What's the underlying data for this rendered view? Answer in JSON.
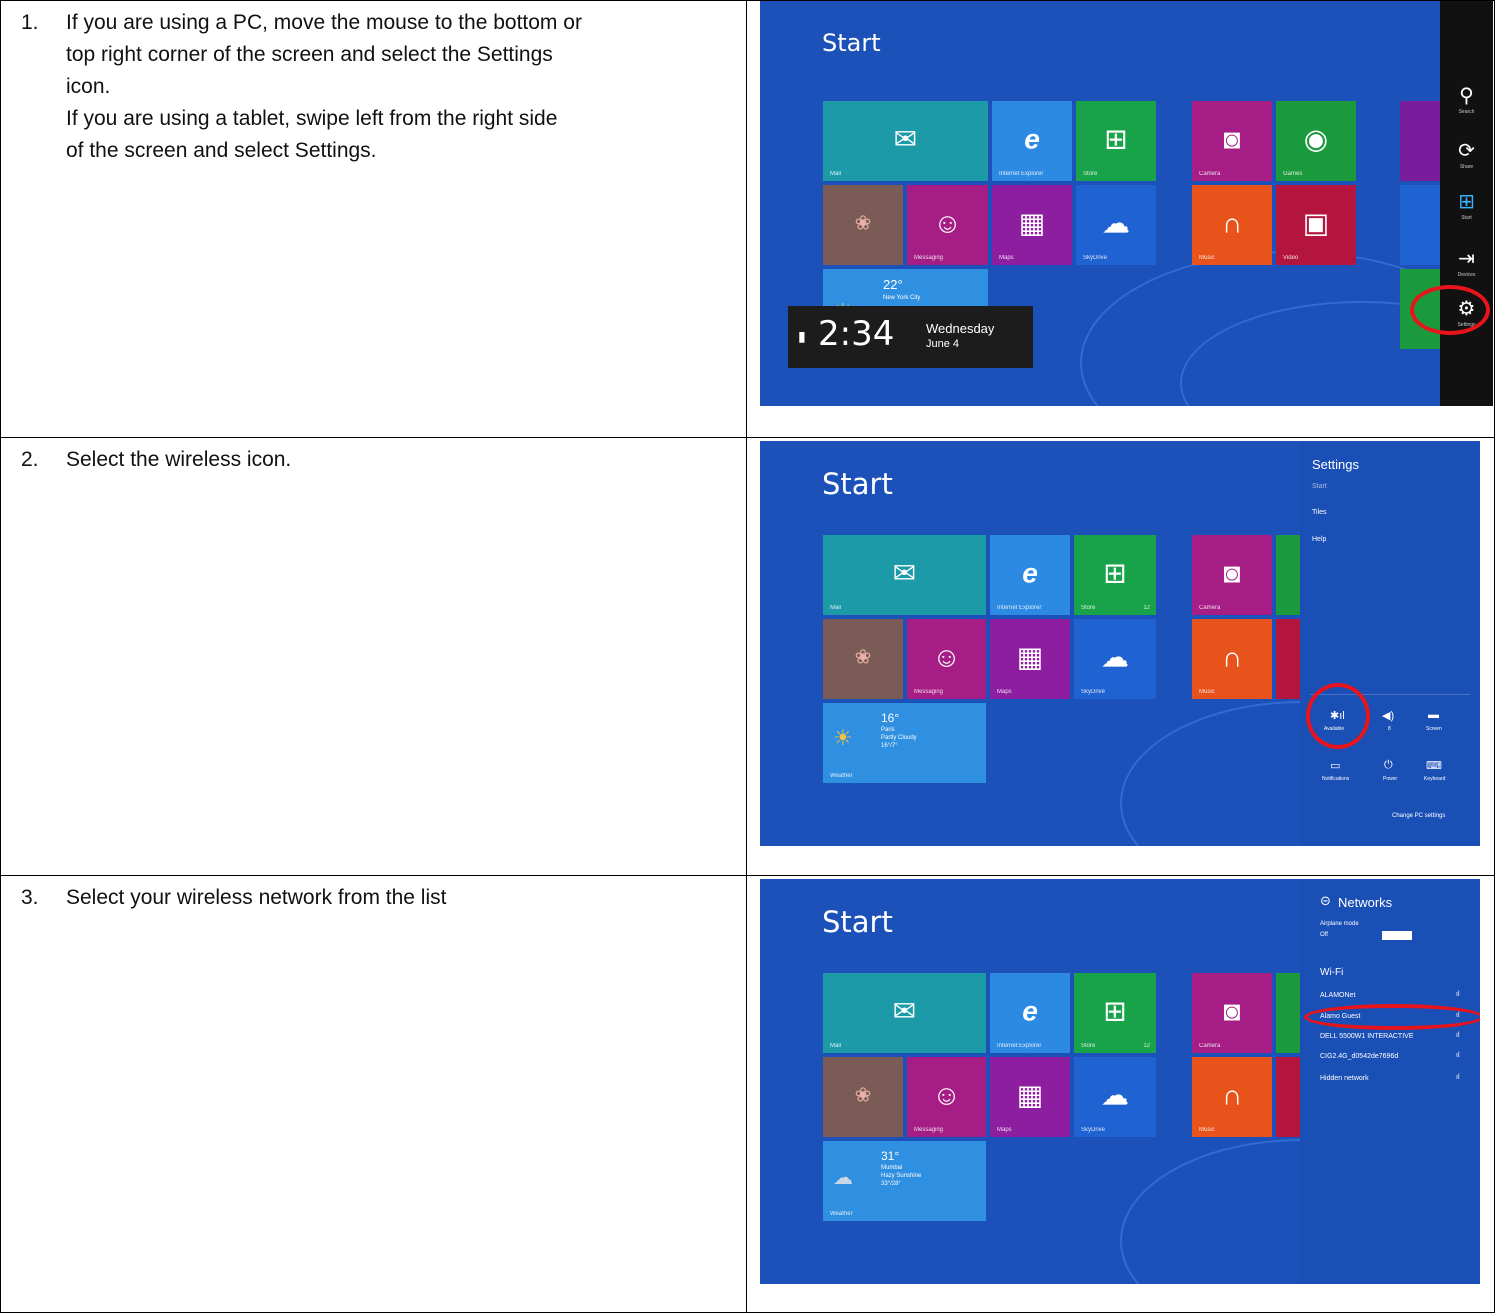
{
  "steps": [
    {
      "number": "1.",
      "lines": [
        "If you are using a PC, move the mouse to the bottom or",
        "top right corner of the screen and select the Settings",
        "icon.",
        "If you are  using a tablet, swipe left from the right side",
        "of the screen and select Settings."
      ]
    },
    {
      "number": "2.",
      "lines": [
        "Select the wireless icon."
      ]
    },
    {
      "number": "3.",
      "lines": [
        "Select your wireless network from the list"
      ]
    }
  ],
  "screens": {
    "start_label": "Start",
    "tiles": {
      "mail": "Mail",
      "ie": "Internet Explorer",
      "store": "Store",
      "store_badge": "12",
      "camera": "Camera",
      "games": "Games",
      "messaging": "Messaging",
      "maps": "Maps",
      "skydrive": "SkyDrive",
      "music": "Music",
      "video": "Video",
      "weather": "Weather"
    },
    "shot1": {
      "weather_temp": "22°",
      "weather_city": "New York City",
      "clock_time": "2:34",
      "clock_day": "Wednesday",
      "clock_date": "June 4",
      "charms": [
        "Search",
        "Share",
        "Start",
        "Devices",
        "Settings"
      ]
    },
    "shot2": {
      "weather_temp": "16°",
      "weather_city": "Paris",
      "weather_desc": "Partly Cloudy",
      "weather_range": "16°/7°",
      "settings_title": "Settings",
      "settings_items": [
        "Start",
        "Tiles",
        "Help"
      ],
      "quick": [
        "Available",
        "8",
        "Screen",
        "Notifications",
        "Power",
        "Keyboard"
      ],
      "change_pc": "Change PC settings"
    },
    "shot3": {
      "weather_temp": "31°",
      "weather_city": "Mumbai",
      "weather_desc": "Hazy Sunshine",
      "weather_range": "33°/28°",
      "networks_title": "Networks",
      "airplane_label": "Airplane mode",
      "airplane_value": "Off",
      "wifi_label": "Wi-Fi",
      "networks": [
        "ALAMONet",
        "Alamo Guest",
        "DELL 5500W1 INTERACTIVE",
        "CIG2.4G_d0542de7696d",
        "Hidden network"
      ]
    }
  },
  "colors": {
    "background_blue": "#1c51b9",
    "mail": "#1c9aa8",
    "ie": "#2d8ae2",
    "store": "#18a34a",
    "camera": "#a51d85",
    "games": "#1a9a3c",
    "messaging": "#a51d85",
    "maps": "#8e1ea0",
    "skydrive": "#1f62d1",
    "music": "#e8531c",
    "video": "#b3153f",
    "weather": "#2f8fe0",
    "highlight": "#e8141c"
  }
}
